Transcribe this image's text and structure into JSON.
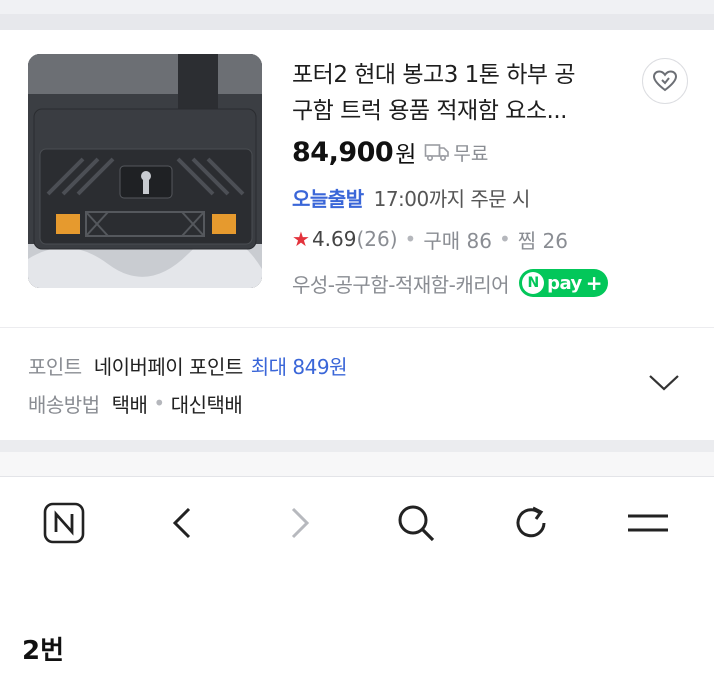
{
  "product": {
    "title_line1": "포터2 현대 봉고3 1톤 하부 공",
    "title_line2": "구함 트럭 용품 적재함 요소...",
    "price": "84,900",
    "currency": "원",
    "shipping": "무료",
    "delivery_badge": "오늘출발",
    "delivery_deadline": "17:00까지 주문 시",
    "rating": "4.69",
    "review_count": "(26)",
    "purchase_label": "구매 86",
    "wish_label": "찜 26",
    "tags": "우성-공구함-적재함-캐리어",
    "npay_label": "pay",
    "npay_n": "N",
    "npay_plus": "+",
    "star": "★"
  },
  "info": {
    "point_label": "포인트",
    "point_value": "네이버페이 포인트",
    "point_max": "최대 849원",
    "delivery_label": "배송방법",
    "delivery_option1": "택배",
    "delivery_option2": "대신택배",
    "separator": "•"
  },
  "toolbar": {
    "items": [
      "naver-home",
      "back",
      "forward",
      "search",
      "reload",
      "menu"
    ]
  },
  "caption": "2번",
  "colors": {
    "accent_blue": "#3a66d8",
    "npay_green": "#03c75a",
    "star_red": "#e3333c"
  }
}
